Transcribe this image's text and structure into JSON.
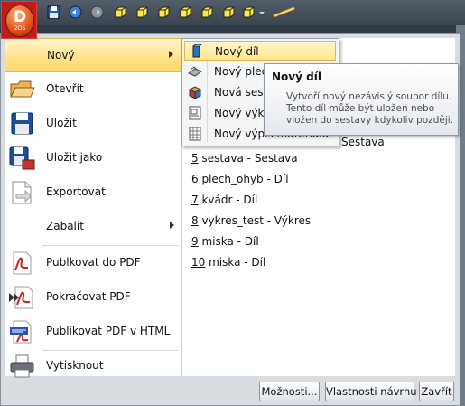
{
  "app_button": {
    "letter": "D",
    "sub": "2DS"
  },
  "quick_access": {
    "icons": [
      "save-icon",
      "undo-icon",
      "redo-icon",
      "cube-icon",
      "cube-icon",
      "cube-icon",
      "cube-icon",
      "cube-icon",
      "cube-icon",
      "dropdown-icon",
      "ruler-icon"
    ]
  },
  "menu": {
    "items": [
      {
        "label": "Nový",
        "icon": "new-icon",
        "has_submenu": true
      },
      {
        "label": "Otevřít",
        "icon": "folder-open-icon"
      },
      {
        "label": "Uložit",
        "icon": "floppy-icon"
      },
      {
        "label": "Uložit jako",
        "icon": "save-as-icon"
      },
      {
        "label": "Exportovat",
        "icon": "export-icon"
      },
      {
        "label": "Zabalit",
        "icon": "package-icon",
        "has_submenu": true
      },
      {
        "label": "Publkovat do PDF",
        "icon": "pdf-icon"
      },
      {
        "label": "Pokračovat PDF",
        "icon": "pdf-continue-icon"
      },
      {
        "label": "Publikovat PDF v HTML",
        "icon": "pdf-html-icon"
      },
      {
        "label": "Vytisknout",
        "icon": "printer-icon"
      }
    ]
  },
  "submenu": {
    "items": [
      {
        "label": "Nový díl",
        "icon": "part-icon"
      },
      {
        "label": "Nový plech",
        "icon": "sheet-metal-icon"
      },
      {
        "label": "Nová sestava",
        "icon": "assembly-icon"
      },
      {
        "label": "Nový výkres",
        "icon": "drawing-icon"
      },
      {
        "label": "Nový výpis materiálu",
        "icon": "bom-icon"
      }
    ]
  },
  "recent": {
    "hidden_item_suffix": "Sestava",
    "items": [
      {
        "num": "5",
        "rest": " sestava - Sestava"
      },
      {
        "num": "6",
        "rest": " plech_ohyb - Díl"
      },
      {
        "num": "7",
        "rest": " kvádr - Díl"
      },
      {
        "num": "8",
        "rest": " vykres_test - Výkres"
      },
      {
        "num": "9",
        "rest": " miska - Díl"
      },
      {
        "num": "10",
        "rest": " miska - Díl"
      }
    ]
  },
  "tooltip": {
    "title": "Nový díl",
    "body": "Vytvoří nový nezávislý soubor dílu. Tento díl může být uložen nebo vložen do sestavy kdykoliv později."
  },
  "footer": {
    "options_label": "Možnosti...",
    "properties_label": "Vlastnosti návrhu",
    "close_label": "Zavřít"
  }
}
